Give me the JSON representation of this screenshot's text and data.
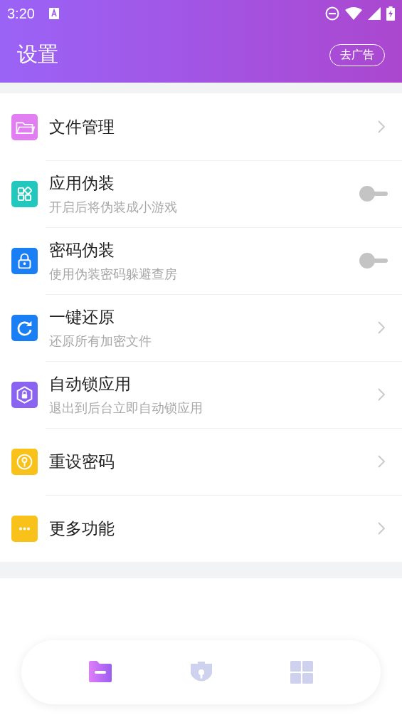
{
  "status_bar": {
    "time": "3:20"
  },
  "header": {
    "title": "设置",
    "action": "去广告"
  },
  "settings": [
    {
      "kind": "chevron",
      "title": "文件管理",
      "color": "#e07ef2"
    },
    {
      "kind": "switch",
      "title": "应用伪装",
      "subtitle": "开启后将伪装成小游戏",
      "on": false,
      "color": "#22c7bd"
    },
    {
      "kind": "switch",
      "title": "密码伪装",
      "subtitle": "使用伪装密码躲避查房",
      "on": false,
      "color": "#1a7ef5"
    },
    {
      "kind": "chevron",
      "title": "一键还原",
      "subtitle": "还原所有加密文件",
      "color": "#1a7ef5"
    },
    {
      "kind": "chevron",
      "title": "自动锁应用",
      "subtitle": "退出到后台立即自动锁应用",
      "color": "#8a63f0"
    },
    {
      "kind": "chevron",
      "title": "重设密码",
      "color": "#f8c21a"
    },
    {
      "kind": "chevron",
      "title": "更多功能",
      "color": "#f8c21a"
    }
  ],
  "bottom_nav": [
    {
      "selected": true
    },
    {
      "selected": false
    },
    {
      "selected": false
    }
  ]
}
